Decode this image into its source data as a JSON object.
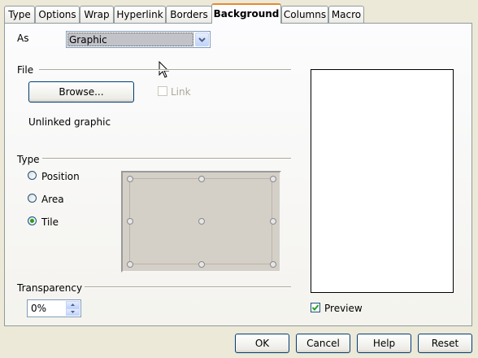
{
  "tabs": [
    {
      "label": "Type"
    },
    {
      "label": "Options"
    },
    {
      "label": "Wrap"
    },
    {
      "label": "Hyperlink"
    },
    {
      "label": "Borders"
    },
    {
      "label": "Background"
    },
    {
      "label": "Columns"
    },
    {
      "label": "Macro"
    }
  ],
  "active_tab": "Background",
  "as_field": {
    "label": "As",
    "value": "Graphic"
  },
  "file_section": {
    "title": "File",
    "browse_label": "Browse...",
    "link_label": "Link",
    "link_checked": false,
    "link_enabled": false,
    "status": "Unlinked graphic"
  },
  "type_section": {
    "title": "Type",
    "options": [
      {
        "label": "Position",
        "selected": false
      },
      {
        "label": "Area",
        "selected": false
      },
      {
        "label": "Tile",
        "selected": true
      }
    ]
  },
  "transparency": {
    "label": "Transparency",
    "value": "0%"
  },
  "preview": {
    "label": "Preview",
    "checked": true
  },
  "buttons": {
    "ok": "OK",
    "cancel": "Cancel",
    "help": "Help",
    "reset": "Reset"
  },
  "colors": {
    "accent": "#e68b2c",
    "check": "#21a121"
  }
}
